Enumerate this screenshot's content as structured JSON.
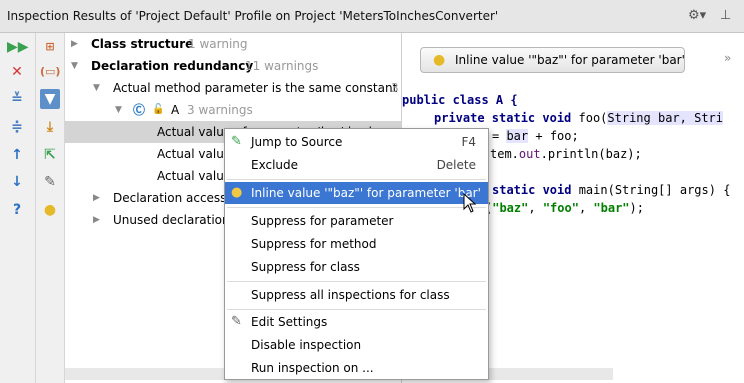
{
  "header": {
    "title": "Inspection Results of 'Project Default' Profile on Project 'MetersToInchesConverter'",
    "settings_icon": "gear-icon",
    "pin_icon": "pin-icon"
  },
  "toolbar": {
    "run_icon": "run-icon",
    "close_icon": "close-icon",
    "expand_icon": "expand-all-icon",
    "collapse_icon": "collapse-all-icon",
    "up_icon": "arrow-up-icon",
    "down_icon": "arrow-down-icon",
    "help_icon": "help-icon"
  },
  "tree": {
    "nodes": [
      {
        "label": "Class structure",
        "count": "1 warning"
      },
      {
        "label": "Declaration redundancy",
        "count": "11 warnings"
      },
      {
        "label": "Actual method parameter is the same constant",
        "count": "3"
      },
      {
        "label": "A",
        "count": "3 warnings"
      },
      {
        "label": "Actual value of parameter 'bar' is always '"
      },
      {
        "label": "Actual valu"
      },
      {
        "label": "Actual valu"
      },
      {
        "label": "Declaration access"
      },
      {
        "label": "Unused declaration"
      }
    ]
  },
  "right": {
    "inline_button": "Inline value '\"baz\"' for parameter 'bar'",
    "more": "»",
    "code": {
      "l1": "public class A {",
      "l2a": "private static void ",
      "l2b": "foo(",
      "l2c": "String bar, Stri",
      "l3a": "= ",
      "l3b": "bar",
      "l3c": " + foo;",
      "l4a": "tem.",
      "l4b": "out",
      "l4c": ".println(baz);",
      "l5a": "static void ",
      "l5b": "main(String[] args) {",
      "l6a": "(",
      "l6b": "\"baz\"",
      "l6c": ", ",
      "l6d": "\"foo\"",
      "l6e": ", ",
      "l6f": "\"bar\"",
      "l6g": ");"
    }
  },
  "menu": {
    "items": [
      {
        "label": "Jump to Source",
        "shortcut": "F4"
      },
      {
        "label": "Exclude",
        "shortcut": "Delete"
      },
      {
        "label": "Inline value '\"baz\"' for parameter 'bar'"
      },
      {
        "label": "Suppress for parameter"
      },
      {
        "label": "Suppress for method"
      },
      {
        "label": "Suppress for class"
      },
      {
        "label": "Suppress all inspections for class"
      },
      {
        "label": "Edit Settings"
      },
      {
        "label": "Disable inspection"
      },
      {
        "label": "Run inspection on ..."
      }
    ]
  }
}
